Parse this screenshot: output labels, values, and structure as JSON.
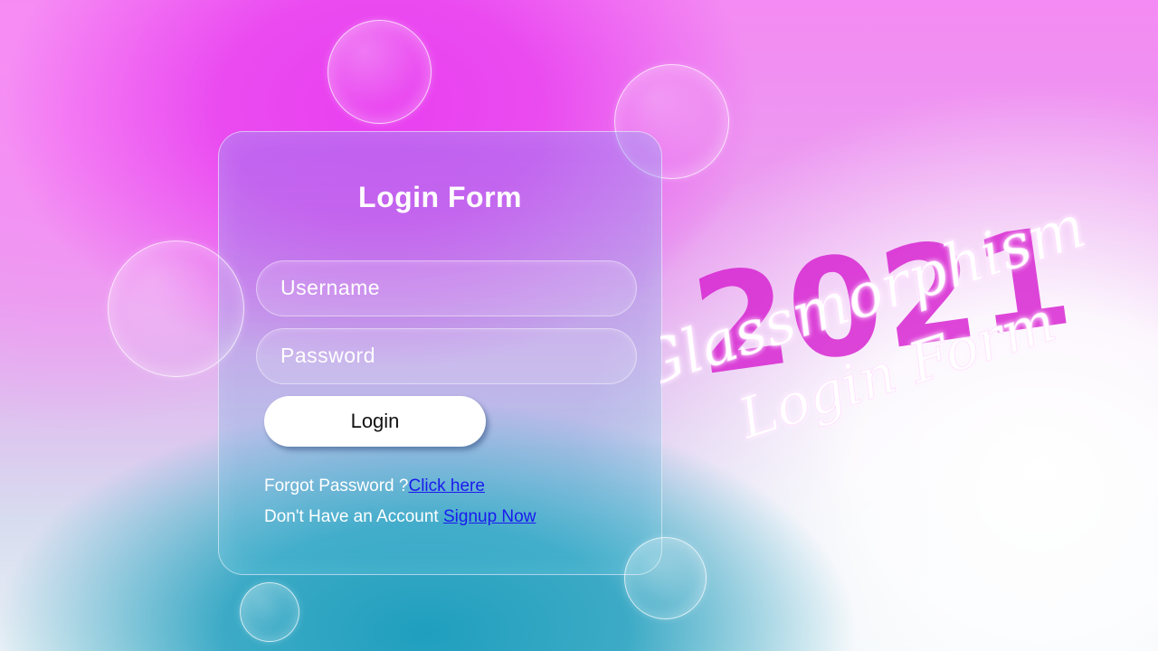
{
  "form": {
    "title": "Login Form",
    "username_placeholder": "Username",
    "password_placeholder": "Password",
    "login_label": "Login"
  },
  "links": {
    "forgot_prefix": "Forgot Password ?",
    "forgot_link": "Click here",
    "signup_prefix": "Don't Have an Account ",
    "signup_link": "Signup Now"
  },
  "decoration": {
    "year": "2021",
    "script_line1": "Glassmorphism",
    "script_line2": "Login Form"
  },
  "colors": {
    "accent_magenta": "#e93ff0",
    "accent_teal": "#1f9fbe",
    "link_blue": "#1a1aee"
  }
}
